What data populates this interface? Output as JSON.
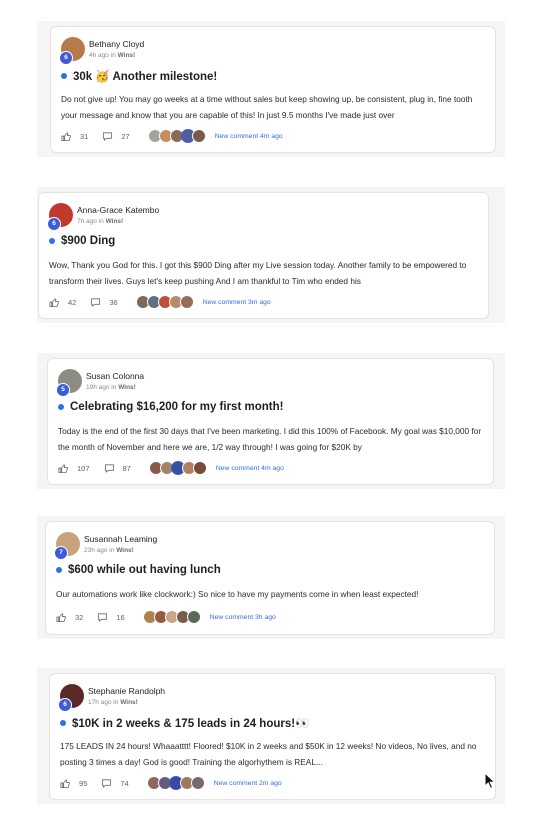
{
  "posts": [
    {
      "author": "Bethany Cloyd",
      "level": "6",
      "time": "4h ago in",
      "category": "Wins!",
      "title": "30k 🥳 Another milestone!",
      "body": "Do not give up! You may go weeks at a time without sales but keep showing up, be consistent, plug in, fine tooth your message and know that you are capable of this! In just 9.5 months I've made just over",
      "likes": "31",
      "comments": "27",
      "new_comment": "New comment 4m ago",
      "avatar_color": "#b77a4e",
      "commenter_colors": [
        "#a7a39c",
        "#c98b5f",
        "#8a6b5a",
        "#4f5f9e",
        "#7b5a4a"
      ]
    },
    {
      "author": "Anna-Grace Katembo",
      "level": "6",
      "time": "7h ago in",
      "category": "Wins!",
      "title": "$900 Ding",
      "body": "Wow, Thank you God for this. I got this $900 Ding after my Live session today. Another family to be empowered to transform their lives. Guys let's keep pushing And I am thankful to Tim who ended his",
      "likes": "42",
      "comments": "36",
      "new_comment": "New comment 3m ago",
      "avatar_color": "#c0392b",
      "commenter_colors": [
        "#7a6a5a",
        "#5f6f7f",
        "#c0503a",
        "#b98b6a",
        "#9a6a5a"
      ]
    },
    {
      "author": "Susan Colonna",
      "level": "5",
      "time": "19h ago in",
      "category": "Wins!",
      "title": "Celebrating $16,200 for my first month!",
      "body": "Today is the end of the first 30 days that I've been marketing. I did this 100% of Facebook. My goal was $10,000 for the month of November and here we are, 1/2 way through! I was going for $20K by",
      "likes": "107",
      "comments": "87",
      "new_comment": "New comment 4m ago",
      "avatar_color": "#8c8c84",
      "commenter_colors": [
        "#8a5a4a",
        "#a7826a",
        "#3a4f9e",
        "#b08060",
        "#7a4a3a"
      ]
    },
    {
      "author": "Susannah Leaming",
      "level": "7",
      "time": "23h ago in",
      "category": "Wins!",
      "title": "$600 while out having lunch",
      "body": "Our automations work like clockwork:) So nice to have my payments come in when least expected!",
      "likes": "32",
      "comments": "16",
      "new_comment": "New comment 3h ago",
      "avatar_color": "#c8a27a",
      "commenter_colors": [
        "#b08050",
        "#9a5a40",
        "#c9a58a",
        "#7a5a4a",
        "#5a6a5a"
      ]
    },
    {
      "author": "Stephanie Randolph",
      "level": "6",
      "time": "17h ago in",
      "category": "Wins!",
      "title": "$10K in 2 weeks & 175 leads in 24 hours!👀",
      "body": "175 LEADS IN 24 hours! Whaaatttt! Floored! $10K in 2 weeks and $50K in 12 weeks! No videos, No lives, and no posting 3 times a day! God is good! Training the algorhythem is REAL...",
      "likes": "95",
      "comments": "74",
      "new_comment": "New comment 2m ago",
      "avatar_color": "#5a2a2a",
      "commenter_colors": [
        "#8a6a5a",
        "#6a5a7a",
        "#3a4a9e",
        "#a0785a",
        "#7a6a6a"
      ]
    }
  ]
}
